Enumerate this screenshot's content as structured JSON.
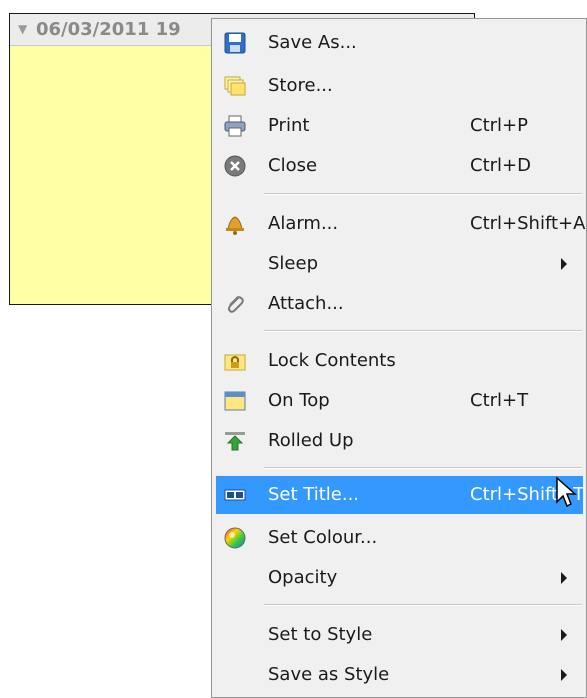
{
  "note": {
    "title": "06/03/2011 19",
    "arrow": "▼"
  },
  "menu": {
    "items": [
      {
        "label": "Save As...",
        "shortcut": "",
        "icon": "save-icon"
      },
      {
        "label": "Store...",
        "shortcut": "",
        "icon": "store-icon"
      },
      {
        "label": "Print",
        "shortcut": "Ctrl+P",
        "icon": "print-icon"
      },
      {
        "label": "Close",
        "shortcut": "Ctrl+D",
        "icon": "close-icon"
      },
      {
        "label": "Alarm...",
        "shortcut": "Ctrl+Shift+A",
        "icon": "bell-icon"
      },
      {
        "label": "Sleep",
        "shortcut": "",
        "submenu": true
      },
      {
        "label": "Attach...",
        "shortcut": "",
        "icon": "paperclip-icon"
      },
      {
        "label": "Lock Contents",
        "shortcut": "",
        "icon": "lock-icon"
      },
      {
        "label": "On Top",
        "shortcut": "Ctrl+T",
        "icon": "window-icon"
      },
      {
        "label": "Rolled Up",
        "shortcut": "",
        "icon": "rolled-up-icon"
      },
      {
        "label": "Set Title...",
        "shortcut": "Ctrl+Shift+T",
        "icon": "title-icon",
        "highlighted": true
      },
      {
        "label": "Set Colour...",
        "shortcut": "",
        "icon": "colour-wheel-icon"
      },
      {
        "label": "Opacity",
        "shortcut": "",
        "submenu": true
      },
      {
        "label": "Set to Style",
        "shortcut": "",
        "submenu": true
      },
      {
        "label": "Save as Style",
        "shortcut": "",
        "submenu": true
      }
    ]
  },
  "colors": {
    "note_background": "#ffffa5",
    "menu_background": "#f0f0f0",
    "highlight": "#3399ff"
  }
}
